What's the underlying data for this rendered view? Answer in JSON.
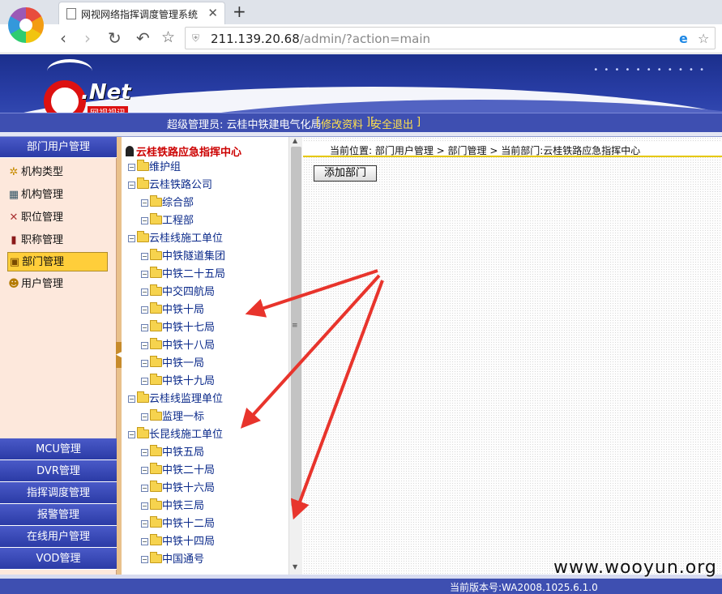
{
  "browser": {
    "tab_title": "网视网络指挥调度管理系统",
    "url_host": "211.139.20.68",
    "url_path": "/admin/?action=main"
  },
  "header": {
    "logo_text": ".Net",
    "logo_sub": "网视视讯",
    "admin_label": "超级管理员: 云桂中铁建电气化局",
    "edit_link": "修改资料",
    "logout_link": "安全退出"
  },
  "sidebar": {
    "section_title": "部门用户管理",
    "items": [
      {
        "label": "机构类型",
        "icon": "gear-icon"
      },
      {
        "label": "机构管理",
        "icon": "card-icon"
      },
      {
        "label": "职位管理",
        "icon": "tools-icon"
      },
      {
        "label": "职称管理",
        "icon": "book-icon"
      },
      {
        "label": "部门管理",
        "icon": "dept-icon",
        "active": true
      },
      {
        "label": "用户管理",
        "icon": "user-icon"
      }
    ],
    "bottom_menus": [
      "MCU管理",
      "DVR管理",
      "指挥调度管理",
      "报警管理",
      "在线用户管理",
      "VOD管理"
    ]
  },
  "tree": {
    "root": "云桂铁路应急指挥中心",
    "nodes": [
      {
        "label": "维护组",
        "level": 0
      },
      {
        "label": "云桂铁路公司",
        "level": 0
      },
      {
        "label": "综合部",
        "level": 1
      },
      {
        "label": "工程部",
        "level": 1
      },
      {
        "label": "云桂线施工单位",
        "level": 0
      },
      {
        "label": "中铁隧道集团",
        "level": 1
      },
      {
        "label": "中铁二十五局",
        "level": 1
      },
      {
        "label": "中交四航局",
        "level": 1
      },
      {
        "label": "中铁十局",
        "level": 1
      },
      {
        "label": "中铁十七局",
        "level": 1
      },
      {
        "label": "中铁十八局",
        "level": 1
      },
      {
        "label": "中铁一局",
        "level": 1
      },
      {
        "label": "中铁十九局",
        "level": 1
      },
      {
        "label": "云桂线监理单位",
        "level": 0
      },
      {
        "label": "监理一标",
        "level": 1
      },
      {
        "label": "长昆线施工单位",
        "level": 0
      },
      {
        "label": "中铁五局",
        "level": 1
      },
      {
        "label": "中铁二十局",
        "level": 1
      },
      {
        "label": "中铁十六局",
        "level": 1
      },
      {
        "label": "中铁三局",
        "level": 1
      },
      {
        "label": "中铁十二局",
        "level": 1
      },
      {
        "label": "中铁十四局",
        "level": 1
      },
      {
        "label": "中国通号",
        "level": 1
      }
    ]
  },
  "content": {
    "breadcrumb": "当前位置: 部门用户管理 > 部门管理 > 当前部门:云桂铁路应急指挥中心",
    "add_button": "添加部门"
  },
  "footer": {
    "version": "当前版本号:WA2008.1025.6.1.0",
    "watermark": "www.wooyun.org"
  },
  "colors": {
    "header_blue": "#2a3fa8",
    "active_item": "#ffce3a",
    "tree_root": "#cc0000",
    "arrow_red": "#e8342c"
  }
}
